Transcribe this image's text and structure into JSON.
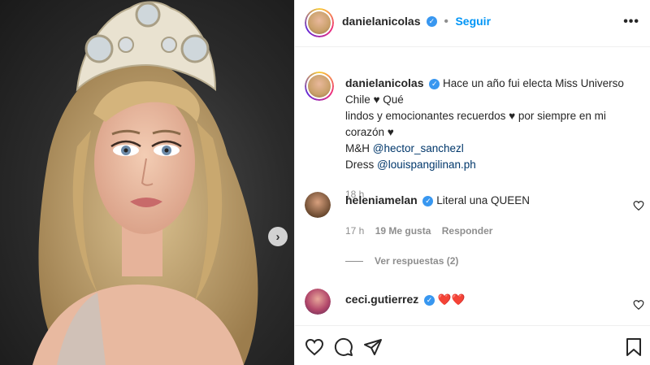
{
  "post": {
    "author": "danielanicolas",
    "follow_label": "Seguir",
    "more_label": "•••"
  },
  "caption": {
    "author": "danielanicolas",
    "text_line1": "Hace un año fui electa Miss Universo Chile ♥ Qué",
    "text_line2": "lindos y emocionantes recuerdos ♥ por siempre en mi corazón ♥",
    "mh_label": "M&H ",
    "mh_mention": "@hector_sanchezl",
    "dress_label": "Dress ",
    "dress_mention": "@louispangilinan.ph",
    "time": "18 h"
  },
  "comments": [
    {
      "author": "heleniamelan",
      "text": "Literal una QUEEN",
      "time": "17 h",
      "likes": "19 Me gusta",
      "reply_label": "Responder",
      "view_replies": "Ver respuestas (2)"
    },
    {
      "author": "ceci.gutierrez",
      "text": "❤️❤️"
    }
  ],
  "carousel": {
    "next_icon": "›"
  },
  "colors": {
    "accent": "#0095f6",
    "verified": "#3897f0",
    "heart": "#ed4956"
  }
}
